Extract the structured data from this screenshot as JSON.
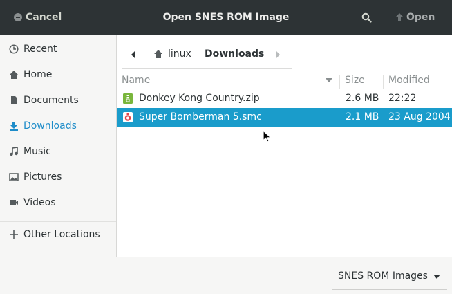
{
  "header": {
    "title": "Open SNES ROM Image",
    "cancel_label": "Cancel",
    "open_label": "Open",
    "search_icon": "search-icon"
  },
  "sidebar": {
    "items": [
      {
        "label": "Recent",
        "icon": "clock-icon"
      },
      {
        "label": "Home",
        "icon": "home-icon"
      },
      {
        "label": "Documents",
        "icon": "document-icon"
      },
      {
        "label": "Downloads",
        "icon": "download-icon",
        "active": true
      },
      {
        "label": "Music",
        "icon": "music-note-icon"
      },
      {
        "label": "Pictures",
        "icon": "picture-icon"
      },
      {
        "label": "Videos",
        "icon": "video-camera-icon"
      },
      {
        "label": "Other Locations",
        "icon": "plus-icon"
      }
    ]
  },
  "pathbar": {
    "segments": [
      {
        "label": "linux",
        "icon": "home-icon"
      },
      {
        "label": "Downloads",
        "current": true
      }
    ]
  },
  "file_list": {
    "columns": [
      "Name",
      "Size",
      "Modified"
    ],
    "rows": [
      {
        "name": "Donkey Kong Country.zip",
        "size": "2.6 MB",
        "modified": "22:22",
        "icon": "zip-archive-icon",
        "selected": false
      },
      {
        "name": "Super Bomberman 5.smc",
        "size": "2.1 MB",
        "modified": "23 Aug 2004",
        "icon": "rom-file-icon",
        "selected": true
      }
    ]
  },
  "filter": {
    "selected": "SNES ROM Images"
  },
  "colors": {
    "header_bg": "#2d3335",
    "accent": "#1d8cc9",
    "selection": "#1a9ccb"
  }
}
